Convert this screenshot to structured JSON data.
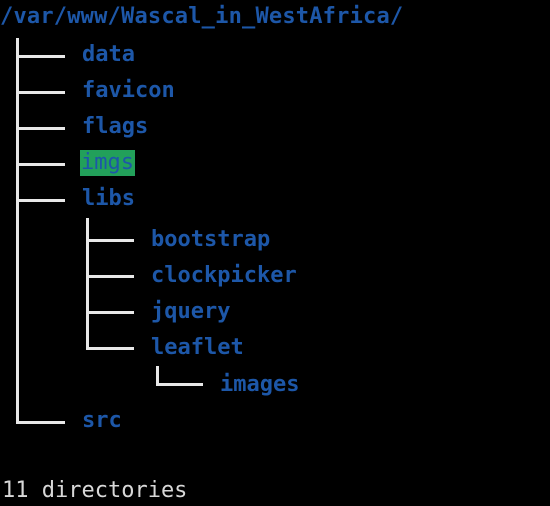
{
  "terminal": {
    "root_path": "/var/www/Wascal_in_WestAfrica/",
    "entries": [
      {
        "name": "data"
      },
      {
        "name": "favicon"
      },
      {
        "name": "flags"
      },
      {
        "name": "imgs"
      },
      {
        "name": "libs"
      },
      {
        "name": "bootstrap"
      },
      {
        "name": "clockpicker"
      },
      {
        "name": "jquery"
      },
      {
        "name": "leaflet"
      },
      {
        "name": "images"
      },
      {
        "name": "src"
      }
    ],
    "summary": "11 directories"
  },
  "colors": {
    "background": "#000000",
    "directory": "#1d57a8",
    "highlight_bg": "#22a05a",
    "tree_lines": "#e8e8e8",
    "summary_text": "#d8d8d8"
  }
}
